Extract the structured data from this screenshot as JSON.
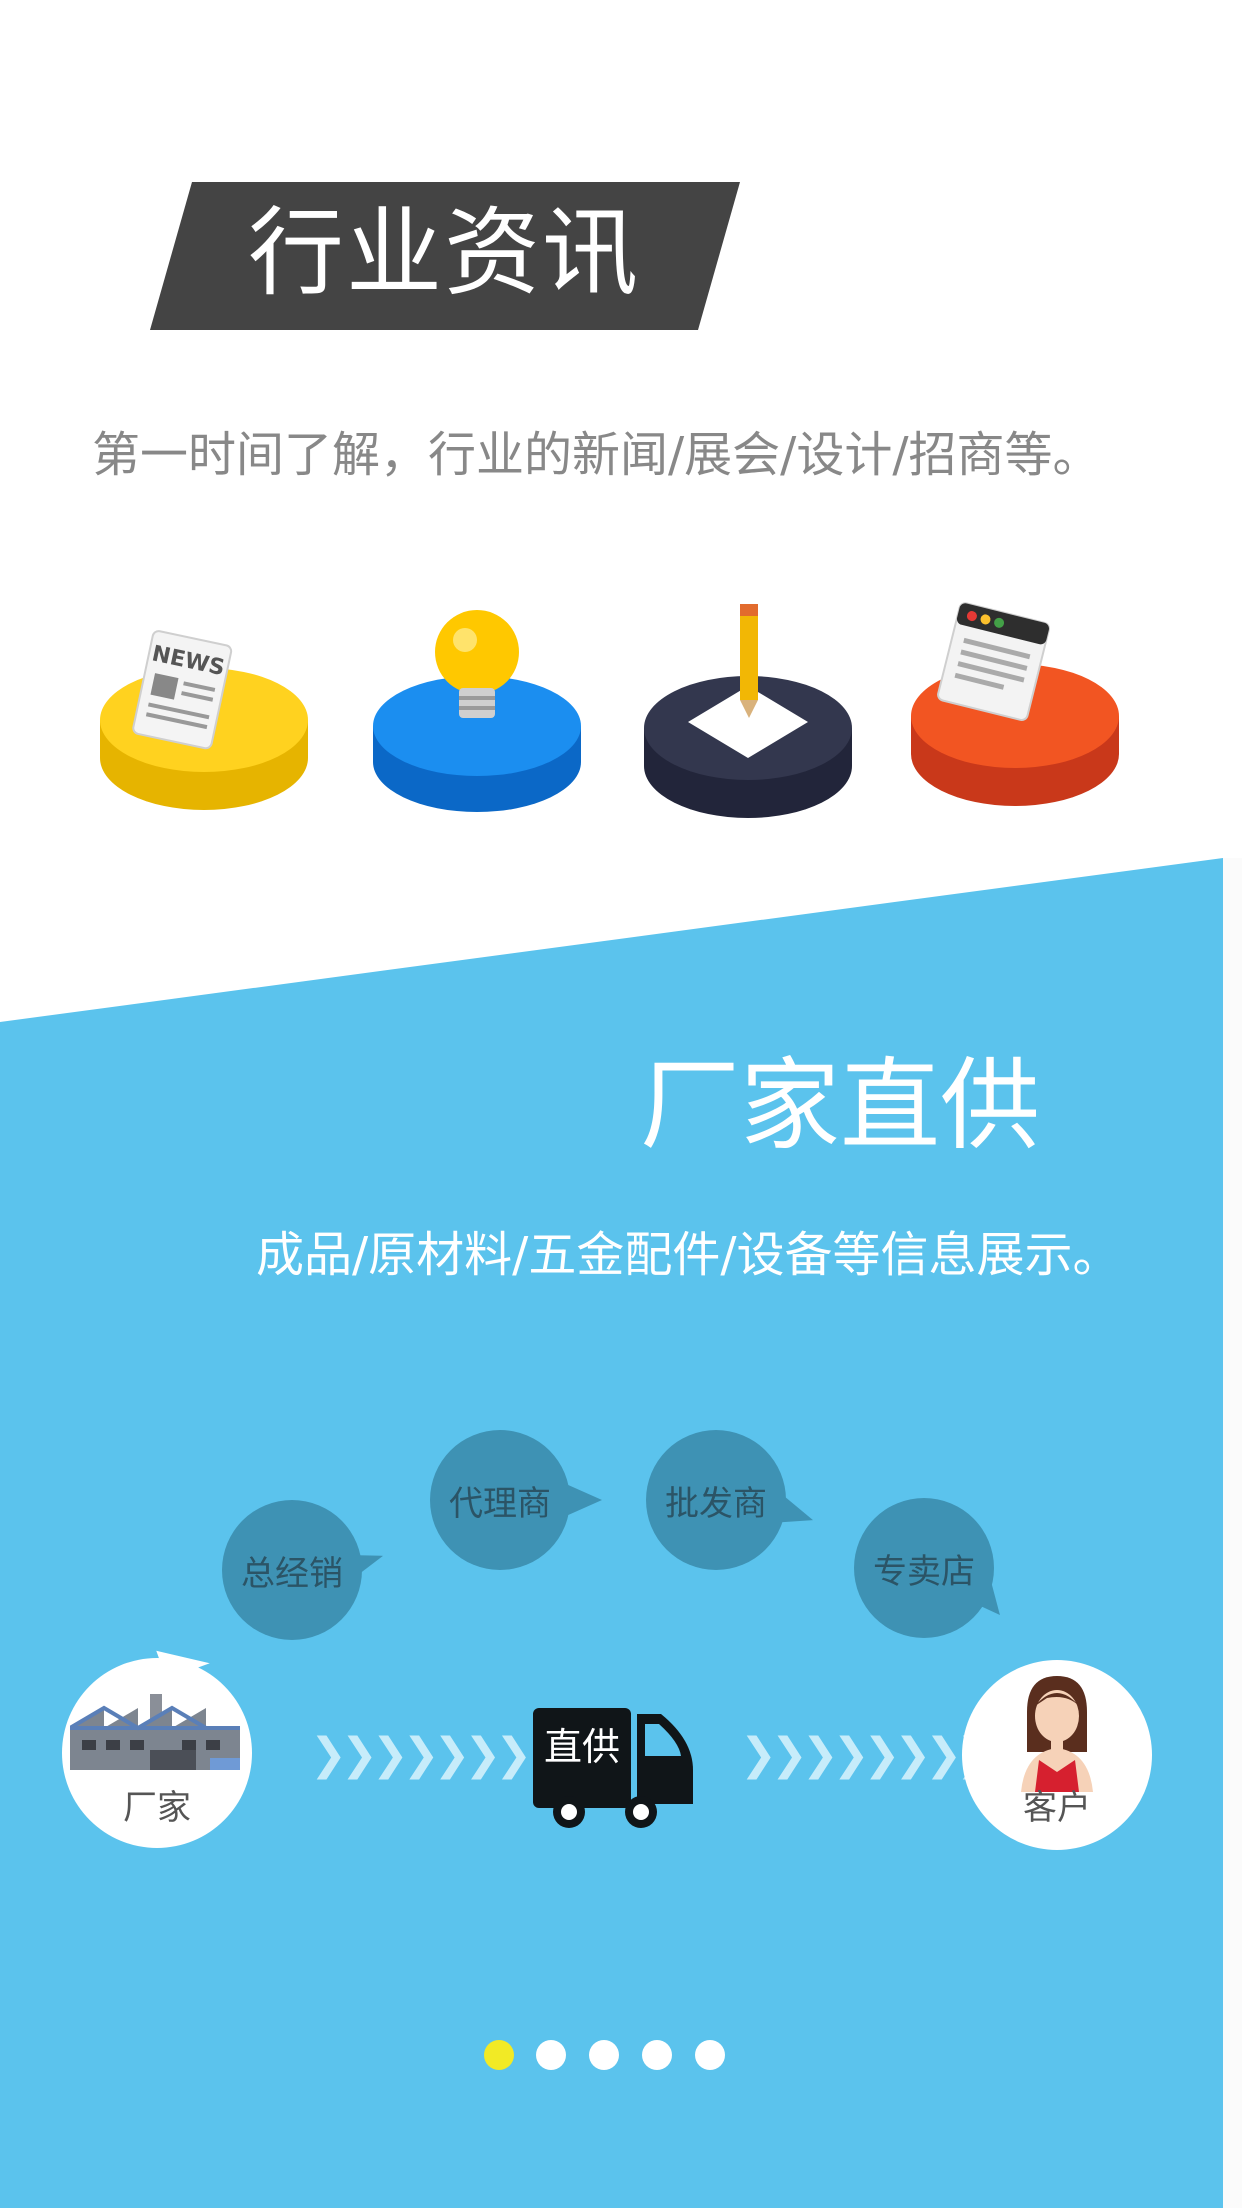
{
  "news_section": {
    "title": "行业资讯",
    "subtitle": "第一时间了解，行业的新闻/展会/设计/招商等。",
    "icons": [
      "news-icon",
      "lightbulb-icon",
      "pencil-pad-icon",
      "browser-window-icon"
    ],
    "icon_text": "NEWS"
  },
  "factory_section": {
    "title": "厂家直供",
    "subtitle": "成品/原材料/五金配件/设备等信息展示。",
    "channels": [
      "总经销",
      "代理商",
      "批发商",
      "专卖店"
    ],
    "manufacturer_label": "厂家",
    "customer_label": "客户",
    "truck_label": "直供"
  },
  "pagination": {
    "total": 5,
    "active": 1
  },
  "colors": {
    "banner": "#444444",
    "blue_bg": "#5bc3ed",
    "bubble": "#3e92b4",
    "active_dot": "#f2ea25"
  }
}
